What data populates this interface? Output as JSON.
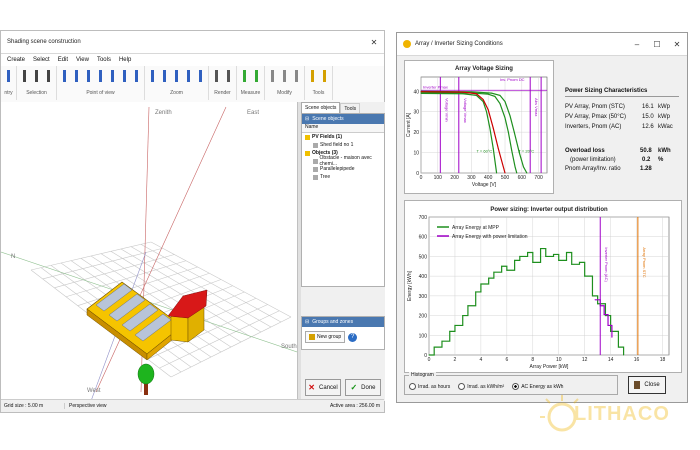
{
  "left_window": {
    "title": "Shading scene construction",
    "menu": [
      "Create",
      "Select",
      "Edit",
      "View",
      "Tools",
      "Help"
    ],
    "toolbar_groups": [
      {
        "label": "ntry"
      },
      {
        "label": "Selection"
      },
      {
        "label": "Point of view"
      },
      {
        "label": "Zoom"
      },
      {
        "label": "Render"
      },
      {
        "label": "Measure"
      },
      {
        "label": "Modify"
      },
      {
        "label": "Tools"
      }
    ],
    "viewport": {
      "axis_zenith": "Zenith",
      "axis_east": "East",
      "axis_south": "South",
      "axis_west": "West",
      "axis_north_label": "N"
    },
    "tabs": [
      "Scene objects",
      "Tools"
    ],
    "scene_objects_header": "Scene objects",
    "tree_column": "Name",
    "tree": [
      {
        "label": "PV Fields (1)",
        "level": 0
      },
      {
        "label": "Shed field no 1",
        "level": 1
      },
      {
        "label": "Objects (3)",
        "level": 0
      },
      {
        "label": "Obstacle - maison avec chemi...",
        "level": 1
      },
      {
        "label": "Parallelepipede",
        "level": 1
      },
      {
        "label": "Tree",
        "level": 1
      }
    ],
    "groups_header": "Groups and zones",
    "new_group": "New group",
    "cancel_label": "Cancel",
    "done_label": "Done",
    "status_left": "Grid size : 5.00 m",
    "status_mid": "Perspective view",
    "status_right": "Active area : 256.00 m"
  },
  "right_window": {
    "title": "Array / Inverter Sizing Conditions",
    "voltage_chart_title": "Array Voltage Sizing",
    "sizing_title": "Power Sizing Characteristics",
    "rows": [
      {
        "label": "PV Array, Pnom (STC)",
        "value": "16.1",
        "unit": "kWp"
      },
      {
        "label": "PV Array, Pmax (50°C)",
        "value": "15.0",
        "unit": "kWp"
      },
      {
        "label": "Inverters, Pnom (AC)",
        "value": "12.6",
        "unit": "kWac"
      }
    ],
    "overload_label": "Overload loss",
    "overload_value": "50.8",
    "overload_unit": "kWh",
    "power_limitation_label": "(power limitation)",
    "power_limitation_value": "0.2",
    "power_limitation_unit": "%",
    "ratio_label": "Pnom Array/Inv. ratio",
    "ratio_value": "1.28",
    "histogram_label": "Histogram",
    "radio_options": [
      "Irrad. as hours",
      "Irrad. as kWh/m²",
      "AC Energy as kWh"
    ],
    "selected_radio": 2,
    "close_label": "Close"
  },
  "watermark": "LITHACO",
  "chart_data": [
    {
      "type": "line",
      "title": "Array Voltage Sizing",
      "xlabel": "Voltage [V]",
      "ylabel": "Current [A]",
      "x_ticks": [
        0,
        100,
        200,
        300,
        400,
        500,
        600,
        700
      ],
      "y_ticks": [
        0,
        10,
        20,
        30,
        40
      ],
      "xlim": [
        0,
        750
      ],
      "ylim": [
        0,
        47
      ],
      "series": [
        {
          "name": "",
          "color": "#1e8f1e",
          "x": [
            0,
            300,
            400,
            440,
            470,
            500,
            520,
            540,
            560,
            570
          ],
          "y": [
            39.5,
            39.2,
            38.6,
            37.5,
            34,
            27,
            20,
            11,
            3,
            0
          ]
        },
        {
          "name": "",
          "color": "#1e8f1e",
          "x": [
            0,
            300,
            420,
            470,
            500,
            530,
            555,
            585,
            610,
            630
          ],
          "y": [
            40,
            39.7,
            39.1,
            38,
            35,
            28,
            20,
            10,
            3,
            0
          ]
        },
        {
          "name": "",
          "color": "#1e8f1e",
          "x": [
            0,
            250,
            330,
            370,
            390,
            410,
            430,
            450
          ],
          "y": [
            39,
            38.8,
            38,
            35,
            30,
            22,
            12,
            0
          ]
        },
        {
          "name": "",
          "color": "#cc0000",
          "x": [
            0,
            250,
            330,
            370,
            400,
            430,
            460,
            500
          ],
          "y": [
            39.8,
            39.6,
            38.8,
            36,
            31,
            22,
            12,
            0
          ]
        }
      ],
      "vlines": [
        {
          "x": 115,
          "label": "Voltage Vmin",
          "color": "#a000c8"
        },
        {
          "x": 225,
          "label": "Voltage Vmax",
          "color": "#a000c8"
        },
        {
          "x": 650,
          "label": "Abs Vmax",
          "color": "#a000c8"
        },
        {
          "x": 715,
          "label": "",
          "color": "#a000c8"
        }
      ],
      "hline": {
        "y": 40.5,
        "label": "Inverter Pmax",
        "color": "#a000c8"
      },
      "annotations": [
        "Inv. Pnom DC",
        "T = 60°C",
        "T = 20°C"
      ]
    },
    {
      "type": "line",
      "title": "Power sizing: Inverter output distribution",
      "xlabel": "Array Power [kW]",
      "ylabel": "Energy [kWh]",
      "x_ticks": [
        0,
        2,
        4,
        6,
        8,
        10,
        12,
        14,
        16,
        18
      ],
      "y_ticks": [
        0,
        100,
        200,
        300,
        400,
        500,
        600,
        700
      ],
      "xlim": [
        0,
        18.5
      ],
      "ylim": [
        0,
        700
      ],
      "legend_position": "top-left",
      "series": [
        {
          "name": "Array Energy at MPP",
          "color": "#1e8f1e",
          "x": [
            0,
            0.4,
            1,
            1.6,
            2,
            2.6,
            3,
            3.6,
            4,
            4.6,
            5,
            5.6,
            6,
            6.6,
            7,
            7.6,
            8,
            8.6,
            9,
            9.6,
            10,
            10.6,
            11,
            11.6,
            12,
            12.6,
            13,
            13.6,
            14,
            14.6,
            15
          ],
          "y": [
            0,
            40,
            70,
            120,
            150,
            200,
            250,
            320,
            360,
            390,
            420,
            450,
            430,
            480,
            500,
            520,
            470,
            540,
            500,
            510,
            480,
            520,
            460,
            470,
            400,
            300,
            260,
            200,
            120,
            40,
            0
          ]
        },
        {
          "name": "Array Energy with power limitation",
          "color": "#a000c8",
          "x": [
            12.8,
            13.2,
            13.5,
            13.8,
            14.1
          ],
          "y": [
            280,
            250,
            205,
            150,
            90
          ]
        }
      ],
      "vlines": [
        {
          "x": 13.2,
          "label": "Inverter Pnom (AC)",
          "color": "#a000c8"
        },
        {
          "x": 16.1,
          "label": "Array Pnom STC",
          "color": "#e07000"
        }
      ],
      "annotations": [
        "Inverter Pnom (AC)",
        "Array Pnom STC"
      ]
    }
  ]
}
